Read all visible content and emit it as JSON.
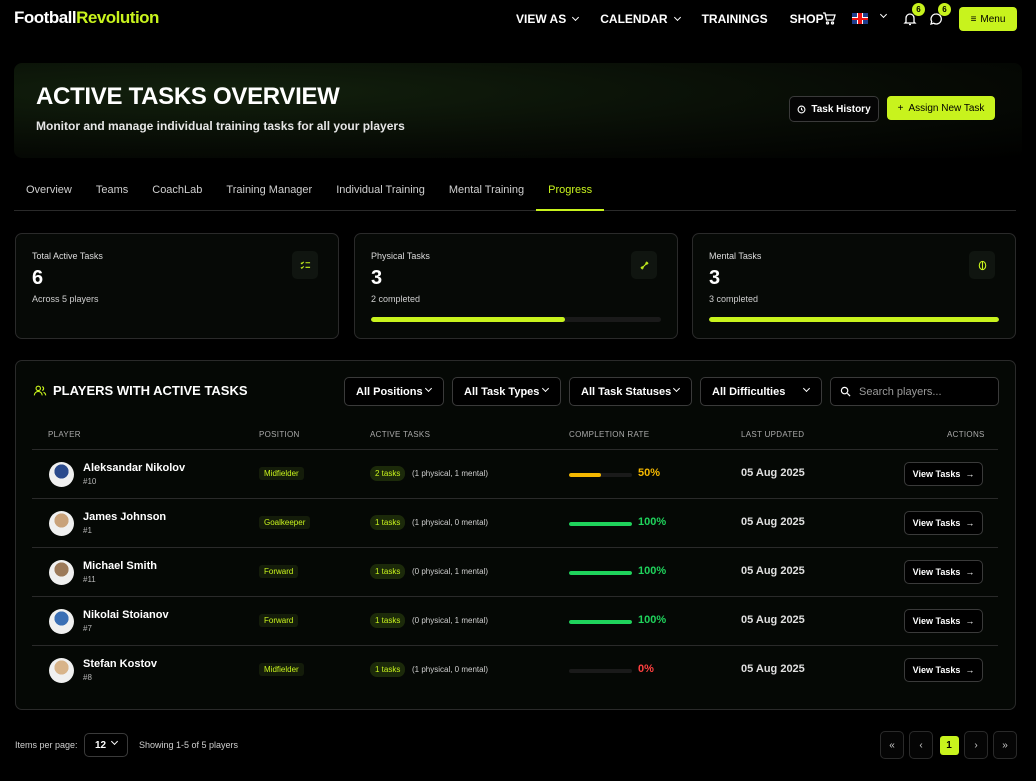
{
  "nav": {
    "logo_a": "Football",
    "logo_b": "Revolution",
    "links": [
      "VIEW AS",
      "CALENDAR",
      "TRAININGS",
      "SHOP"
    ],
    "notifications_count": "6",
    "messages_count": "6",
    "menu_label": "Menu"
  },
  "hero": {
    "title": "ACTIVE TASKS OVERVIEW",
    "subtitle": "Monitor and manage individual training tasks for all your players",
    "history_label": "Task History",
    "assign_label": "Assign New Task"
  },
  "tabs": [
    "Overview",
    "Teams",
    "CoachLab",
    "Training Manager",
    "Individual Training",
    "Mental Training",
    "Progress"
  ],
  "active_tab": "Progress",
  "stats": [
    {
      "label": "Total Active Tasks",
      "value": "6",
      "sub": "Across 5 players"
    },
    {
      "label": "Physical Tasks",
      "value": "3",
      "sub": "2 completed",
      "progress": 0.67
    },
    {
      "label": "Mental Tasks",
      "value": "3",
      "sub": "3 completed",
      "progress": 1.0
    }
  ],
  "panel": {
    "title": "PLAYERS WITH ACTIVE TASKS",
    "filters": [
      "All Positions",
      "All Task Types",
      "All Task Statuses",
      "All Difficulties"
    ],
    "search_placeholder": "Search players...",
    "columns": [
      "PLAYER",
      "POSITION",
      "ACTIVE TASKS",
      "COMPLETION RATE",
      "LAST UPDATED",
      "ACTIONS"
    ],
    "view_label": "View Tasks",
    "rows": [
      {
        "name": "Aleksandar Nikolov",
        "number": "#10",
        "position": "Midfielder",
        "tasks": "2 tasks",
        "detail": "(1 physical, 1 mental)",
        "rate": "50%",
        "rate_value": 0.5,
        "updated": "05 Aug 2025"
      },
      {
        "name": "James Johnson",
        "number": "#1",
        "position": "Goalkeeper",
        "tasks": "1 tasks",
        "detail": "(1 physical, 0 mental)",
        "rate": "100%",
        "rate_value": 1.0,
        "updated": "05 Aug 2025"
      },
      {
        "name": "Michael Smith",
        "number": "#11",
        "position": "Forward",
        "tasks": "1 tasks",
        "detail": "(0 physical, 1 mental)",
        "rate": "100%",
        "rate_value": 1.0,
        "updated": "05 Aug 2025"
      },
      {
        "name": "Nikolai Stoianov",
        "number": "#7",
        "position": "Forward",
        "tasks": "1 tasks",
        "detail": "(0 physical, 1 mental)",
        "rate": "100%",
        "rate_value": 1.0,
        "updated": "05 Aug 2025"
      },
      {
        "name": "Stefan Kostov",
        "number": "#8",
        "position": "Midfielder",
        "tasks": "1 tasks",
        "detail": "(1 physical, 0 mental)",
        "rate": "0%",
        "rate_value": 0.0,
        "updated": "05 Aug 2025"
      }
    ]
  },
  "pagination": {
    "items_label": "Items per page:",
    "items_value": "12",
    "showing": "Showing 1-5 of 5 players",
    "current_page": "1"
  },
  "colors": {
    "accent": "#c8f31d",
    "success": "#1fd35c",
    "warning": "#f5b800",
    "danger": "#ff4040"
  }
}
